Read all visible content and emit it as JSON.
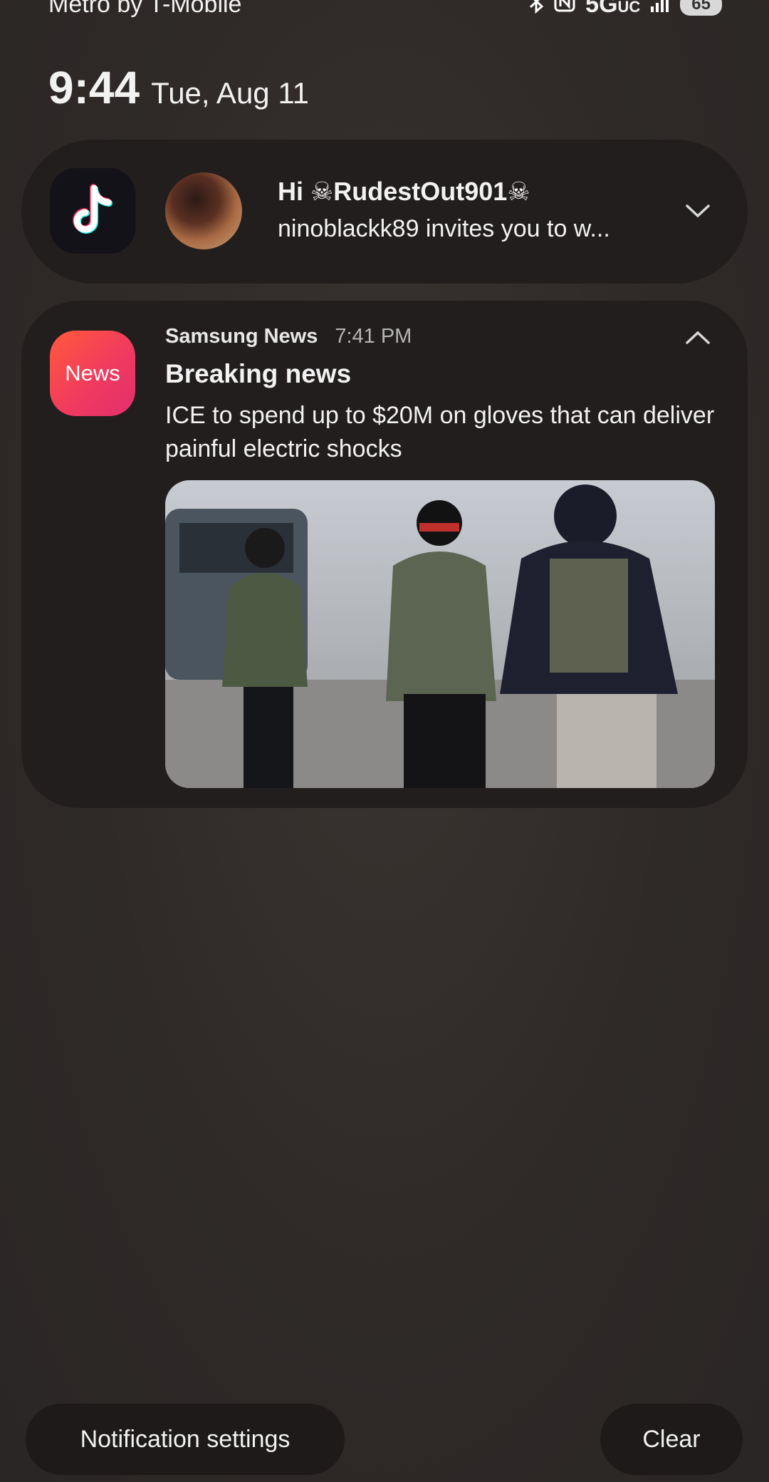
{
  "status_bar": {
    "carrier": "Metro by T-Mobile",
    "network": "5G",
    "network_suffix": "UC",
    "battery": "65",
    "icons": [
      "bluetooth-icon",
      "nfc-icon",
      "signal-icon",
      "battery-icon"
    ]
  },
  "clock": {
    "time": "9:44",
    "date": "Tue, Aug 11"
  },
  "notifications": [
    {
      "app": "TikTok",
      "icon": "tiktok-icon",
      "title": "Hi ☠RudestOut901☠",
      "body": "ninoblackk89 invites you to w...",
      "expand_icon": "chevron-down-icon"
    },
    {
      "app": "Samsung News",
      "icon_label": "News",
      "time": "7:41 PM",
      "title": "Breaking news",
      "body": "ICE to spend up to $20M on gloves that can deliver painful electric shocks",
      "collapse_icon": "chevron-up-icon",
      "image": "news-photo"
    }
  ],
  "actions": {
    "settings_label": "Notification settings",
    "clear_label": "Clear"
  },
  "colors": {
    "background": "#2f2a28",
    "card": "#221e1d",
    "news_gradient_start": "#ff5a3c",
    "news_gradient_end": "#e0306e",
    "tiktok_cyan": "#25f4ee",
    "tiktok_red": "#fe2c55"
  }
}
